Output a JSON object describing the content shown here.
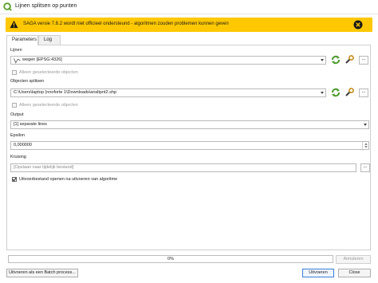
{
  "window": {
    "title": "Lijnen splitsen op punten"
  },
  "banner": {
    "text": "SAGA versie 7.8.2 wordt niet officieel ondersteund - algoritmen zouden problemen kunnen geven",
    "color": "#ffc800"
  },
  "tabs": [
    {
      "label": "Parameters",
      "active": true
    },
    {
      "label": "Log",
      "active": false
    }
  ],
  "params": {
    "lijnen": {
      "label": "Lijnen",
      "value": "wegen [EPSG:4326]",
      "selected_only": "Alleen geselecteerde objecten"
    },
    "objecten": {
      "label": "Objecten splitsen",
      "value": "C:\\Users\\laptop (nnoforte 1\\Downloads\\ansltpnt2.shp",
      "selected_only": "Alleen geselecteerde objecten"
    },
    "output": {
      "label": "Output",
      "value": "[1] separate lines"
    },
    "epsilon": {
      "label": "Epsilon",
      "value": "0,000000"
    },
    "kruising": {
      "label": "Kruising",
      "placeholder": "[Opslaan naar tijdelijk bestand]"
    },
    "open_output": {
      "label": "Uitvoerbestand openen na uitvoeren van algoritme",
      "checked": true
    }
  },
  "progress": {
    "value": 0,
    "text": "0%"
  },
  "buttons": {
    "cancel": "Annuleren",
    "batch": "Uitvoeren als een Batch process...",
    "run": "Uitvoeren",
    "close": "Close",
    "browse": "..."
  },
  "icons": {
    "app": "qgis-icon",
    "warning": "warning-icon",
    "close": "close-icon",
    "iterate": "iterate-icon",
    "wrench": "wrench-icon"
  }
}
